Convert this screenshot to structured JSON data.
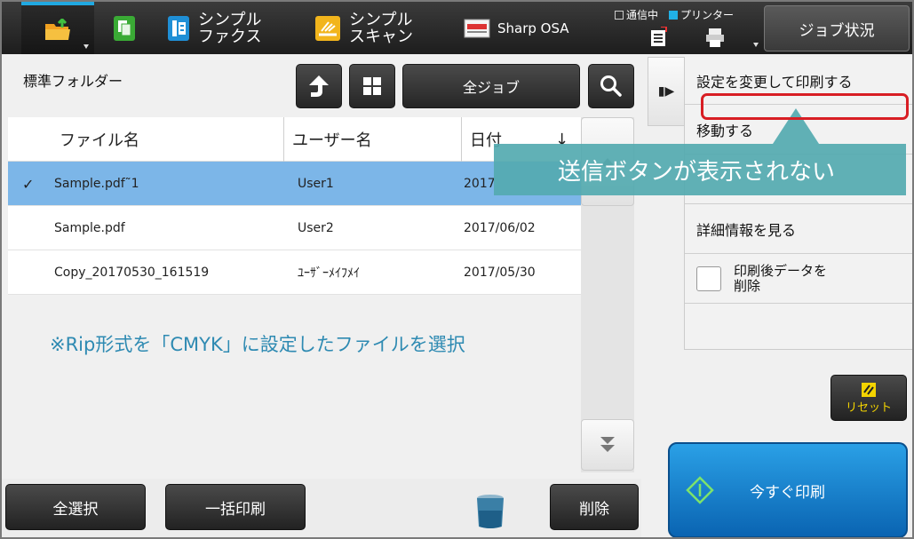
{
  "topbar": {
    "fax_label_1": "シンプル",
    "fax_label_2": "ファクス",
    "scan_label_1": "シンプル",
    "scan_label_2": "スキャン",
    "osa_label": "Sharp OSA",
    "status_comm": "通信中",
    "status_printer": "プリンター",
    "job_status_label": "ジョブ状況"
  },
  "left": {
    "folder_title": "標準フォルダー",
    "all_jobs_label": "全ジョブ",
    "columns": {
      "filename": "ファイル名",
      "username": "ユーザー名",
      "date": "日付"
    },
    "rows": [
      {
        "name": "Sample.pdf˜1",
        "user": "User1",
        "date": "2017",
        "selected": true
      },
      {
        "name": "Sample.pdf",
        "user": "User2",
        "date": "2017/06/02",
        "selected": false
      },
      {
        "name": "Copy_20170530_161519",
        "user": "ﾕｰｻﾞｰﾒｲﾌﾒｲ",
        "date": "2017/05/30",
        "selected": false
      }
    ],
    "note": "※Rip形式を「CMYK」に設定したファイルを選択"
  },
  "bottom": {
    "select_all_label": "全選択",
    "bulk_print_label": "一括印刷",
    "delete_label": "削除"
  },
  "right": {
    "item_change_print": "設定を変更して印刷する",
    "item_move": "移動する",
    "item_details": "詳細情報を見る",
    "item_delete_after_1": "印刷後データを",
    "item_delete_after_2": "削除",
    "reset_label": "リセット",
    "print_now_label": "今すぐ印刷"
  },
  "annotation": {
    "callout_text": "送信ボタンが表示されない"
  },
  "colors": {
    "accent_blue": "#21a9e1",
    "selected_row": "#7cb6e8",
    "callout_teal": "#54aab0",
    "highlight_red": "#d81e24",
    "print_button_blue": "#1a86d0"
  }
}
